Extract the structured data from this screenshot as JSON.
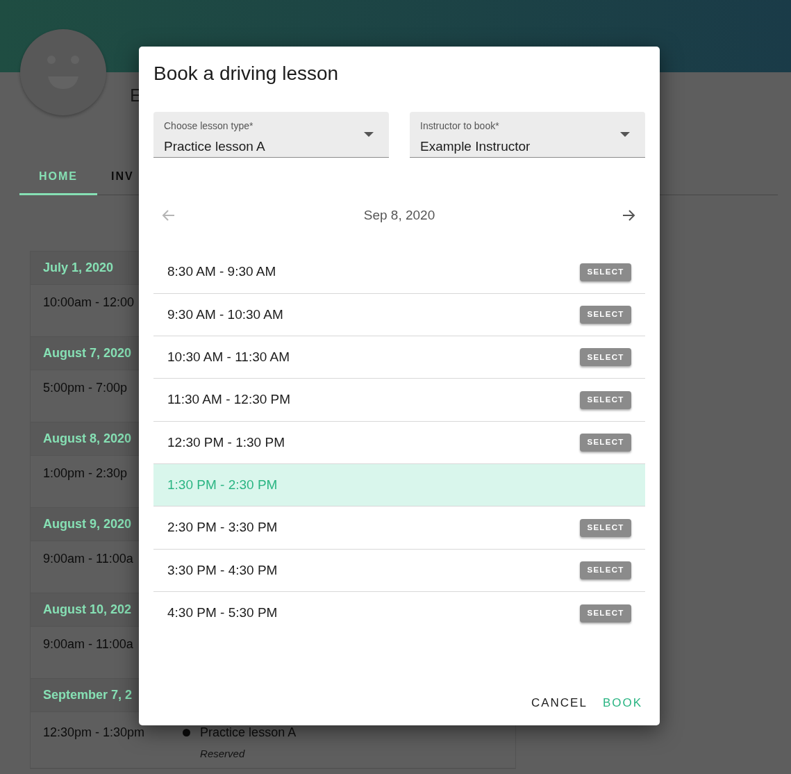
{
  "profile": {
    "name": "E"
  },
  "tabs": [
    {
      "label": "HOME",
      "selected": true
    },
    {
      "label": "INV",
      "selected": false
    }
  ],
  "schedule": [
    {
      "date": "July 1, 2020",
      "time": "10:00am - 12:00"
    },
    {
      "date": "August 7, 2020",
      "time": "5:00pm - 7:00p"
    },
    {
      "date": "August 8, 2020",
      "time": "1:00pm - 2:30p"
    },
    {
      "date": "August 9, 2020",
      "time": "9:00am - 11:00a"
    },
    {
      "date": "August 10, 202",
      "time": "9:00am - 11:00a"
    },
    {
      "date": "September 7, 2",
      "time": "12:30pm - 1:30pm",
      "lesson": "Practice lesson A",
      "status": "Reserved"
    }
  ],
  "dialog": {
    "title": "Book a driving lesson",
    "fields": [
      {
        "label": "Choose lesson type*",
        "value": "Practice lesson A"
      },
      {
        "label": "Instructor to book*",
        "value": "Example Instructor"
      }
    ],
    "date": "Sep 8, 2020",
    "prev_disabled": true,
    "slots": [
      {
        "time": "8:30 AM - 9:30 AM",
        "selected": false,
        "button": "SELECT"
      },
      {
        "time": "9:30 AM - 10:30 AM",
        "selected": false,
        "button": "SELECT"
      },
      {
        "time": "10:30 AM - 11:30 AM",
        "selected": false,
        "button": "SELECT"
      },
      {
        "time": "11:30 AM - 12:30 PM",
        "selected": false,
        "button": "SELECT"
      },
      {
        "time": "12:30 PM - 1:30 PM",
        "selected": false,
        "button": "SELECT"
      },
      {
        "time": "1:30 PM - 2:30 PM",
        "selected": true
      },
      {
        "time": "2:30 PM - 3:30 PM",
        "selected": false,
        "button": "SELECT"
      },
      {
        "time": "3:30 PM - 4:30 PM",
        "selected": false,
        "button": "SELECT"
      },
      {
        "time": "4:30 PM - 5:30 PM",
        "selected": false,
        "button": "SELECT"
      }
    ],
    "actions": [
      {
        "label": "CANCEL",
        "kind": "cancel"
      },
      {
        "label": "BOOK",
        "kind": "primary"
      }
    ]
  }
}
